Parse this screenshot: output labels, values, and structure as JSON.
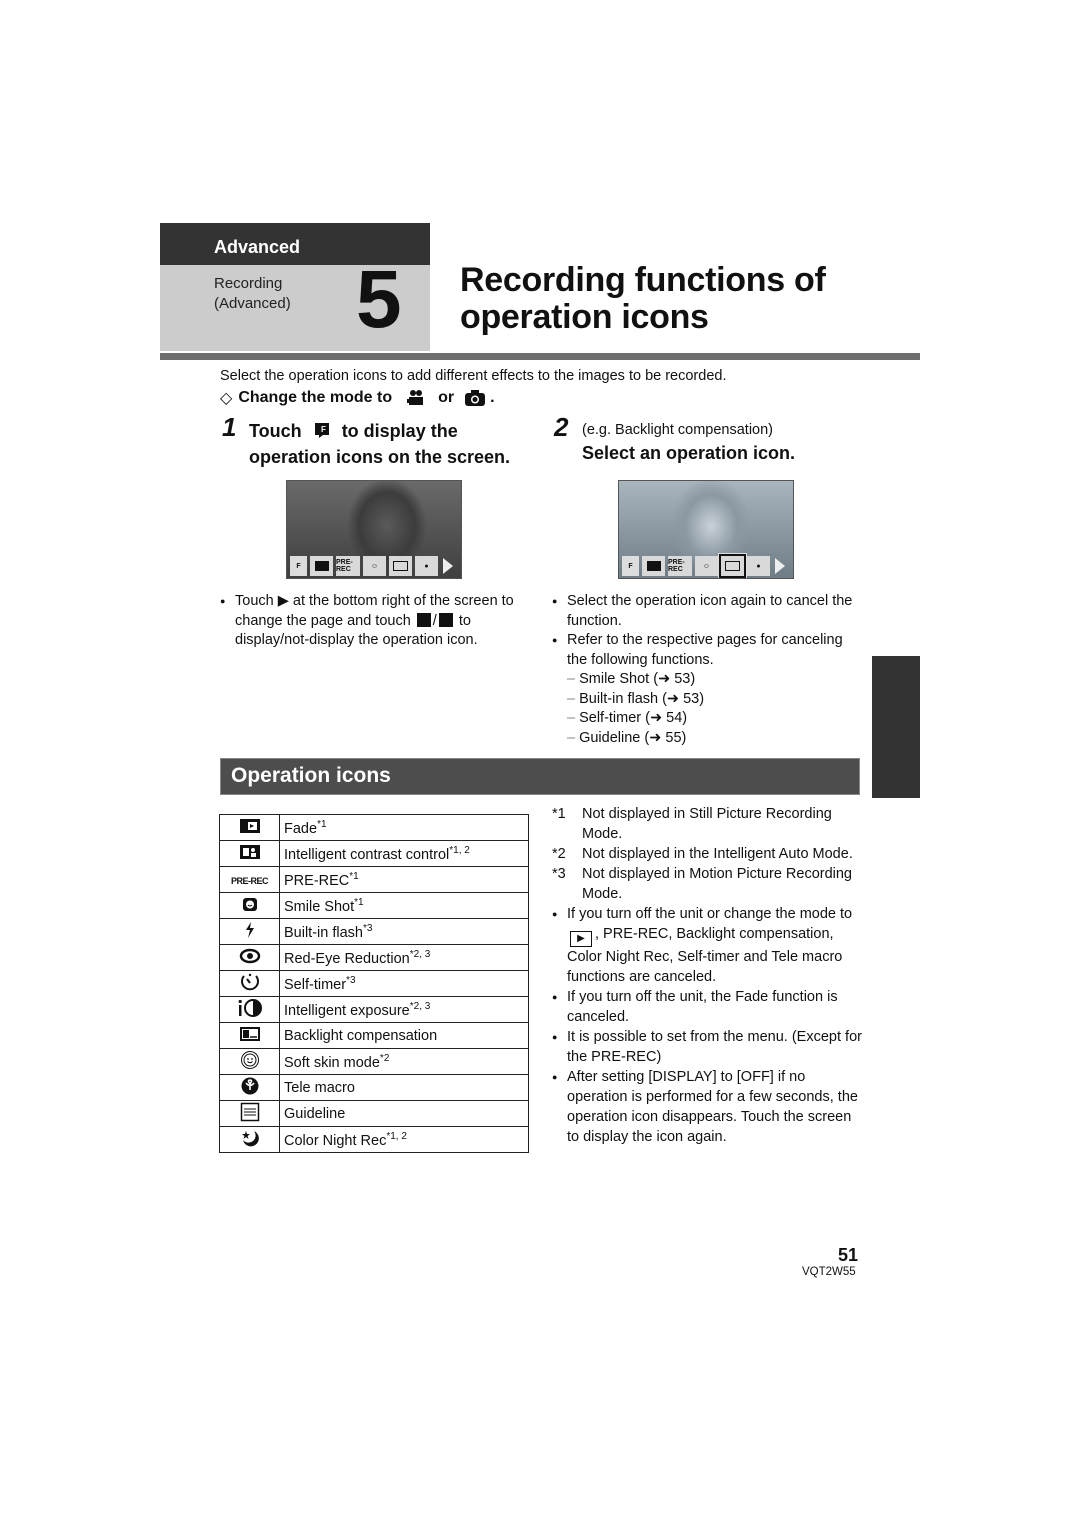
{
  "header": {
    "category": "Advanced",
    "subcategory": [
      "Recording",
      "(Advanced)"
    ],
    "chapter_number": "5",
    "title_lines": [
      "Recording functions of",
      "operation icons"
    ]
  },
  "intro": "Select the operation icons to add different effects to the images to be recorded.",
  "mode_line": {
    "prefix": "◇",
    "text": "Change the mode to",
    "icon1": "motion-picture-icon",
    "or": "or",
    "icon2": "camera-icon",
    "suffix": "."
  },
  "steps": [
    {
      "number": "1",
      "line1_a": "Touch",
      "icon": "operation-icon-toggle",
      "line1_b": "to display the",
      "line2": "operation icons on the screen."
    },
    {
      "number": "2",
      "note": "(e.g. Backlight compensation)",
      "text": "Select an operation icon."
    }
  ],
  "screen_icons": [
    "F",
    "fade",
    "PRE-REC",
    "smile",
    "backlight",
    "tele-macro",
    "next"
  ],
  "col1_notes": {
    "bullet": "Touch ▶ at the bottom right of the screen to change the page and touch",
    "bullet_tail": "to display/not-display the operation icon."
  },
  "col2_notes": {
    "bullets": [
      "Select the operation icon again to cancel the function.",
      "Refer to the respective pages for canceling the following functions."
    ],
    "subitems": [
      "Smile Shot (➜ 53)",
      "Built-in flash (➜ 53)",
      "Self-timer (➜ 54)",
      "Guideline (➜ 55)"
    ]
  },
  "section_title": "Operation icons",
  "operation_icons": [
    {
      "icon": "fade-icon",
      "label": "Fade",
      "note": "*1"
    },
    {
      "icon": "intelligent-contrast-icon",
      "label": "Intelligent contrast control",
      "note": "*1, 2"
    },
    {
      "icon": "pre-rec-icon",
      "label": "PRE-REC",
      "note": "*1"
    },
    {
      "icon": "smile-shot-icon",
      "label": "Smile Shot",
      "note": "*1"
    },
    {
      "icon": "flash-icon",
      "label": "Built-in flash",
      "note": "*3"
    },
    {
      "icon": "red-eye-icon",
      "label": "Red-Eye Reduction",
      "note": "*2, 3"
    },
    {
      "icon": "self-timer-icon",
      "label": "Self-timer",
      "note": "*3"
    },
    {
      "icon": "intelligent-exposure-icon",
      "label": "Intelligent exposure",
      "note": "*2, 3"
    },
    {
      "icon": "backlight-icon",
      "label": "Backlight compensation",
      "note": ""
    },
    {
      "icon": "soft-skin-icon",
      "label": "Soft skin mode",
      "note": "*2"
    },
    {
      "icon": "tele-macro-icon",
      "label": "Tele macro",
      "note": ""
    },
    {
      "icon": "guideline-icon",
      "label": "Guideline",
      "note": ""
    },
    {
      "icon": "color-night-icon",
      "label": "Color Night Rec",
      "note": "*1, 2"
    }
  ],
  "footnotes": [
    {
      "key": "*1",
      "text": "Not displayed in Still Picture Recording Mode."
    },
    {
      "key": "*2",
      "text": "Not displayed in the Intelligent Auto Mode."
    },
    {
      "key": "*3",
      "text": "Not displayed in Motion Picture Recording Mode."
    }
  ],
  "notes": {
    "n1_a": "If you turn off the unit or change the mode to",
    "n1_b": ", PRE-REC, Backlight compensation, Color Night Rec, Self-timer and Tele macro functions are canceled.",
    "n2": "If you turn off the unit, the Fade function is canceled.",
    "n3": "It is possible to set from the menu. (Except for the PRE-REC)",
    "n4": "After setting [DISPLAY] to [OFF] if no operation is performed for a few seconds, the operation icon disappears. Touch the screen to display the icon again."
  },
  "page": {
    "number": "51",
    "code": "VQT2W55"
  }
}
